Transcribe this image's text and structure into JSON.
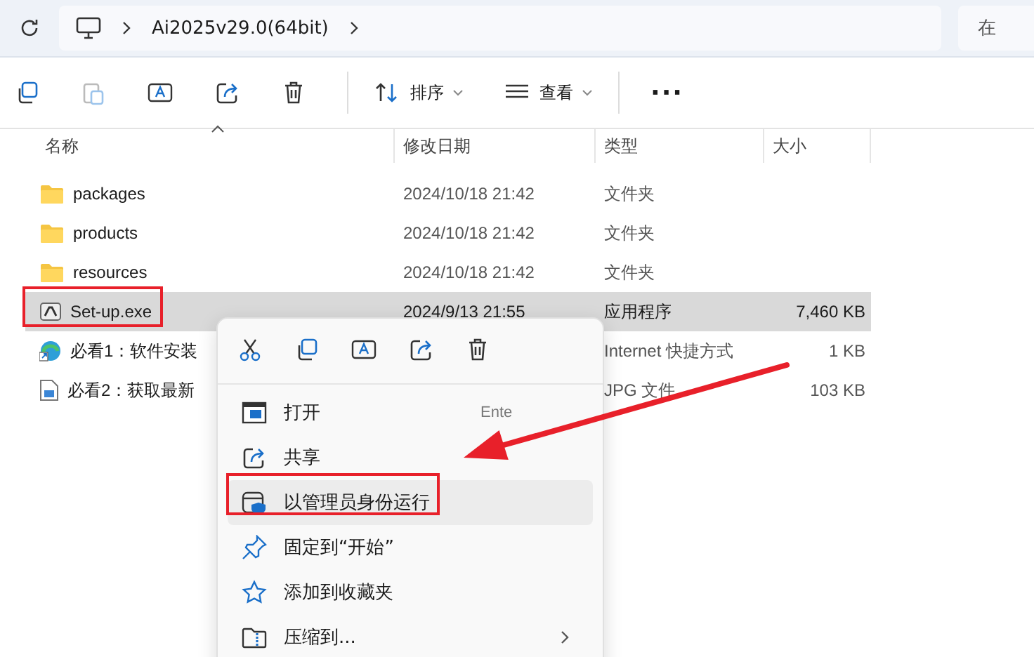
{
  "address_bar": {
    "path": [
      "Ai2025v29.0(64bit)"
    ],
    "search_placeholder": "在"
  },
  "toolbar": {
    "sort_label": "排序",
    "view_label": "查看",
    "more": "···"
  },
  "table": {
    "columns": [
      "名称",
      "修改日期",
      "类型",
      "大小"
    ],
    "rows": [
      {
        "kind": "folder",
        "name": "packages",
        "date": "2024/10/18 21:42",
        "type": "文件夹",
        "selected": false
      },
      {
        "kind": "folder",
        "name": "products",
        "date": "2024/10/18 21:42",
        "type": "文件夹",
        "selected": false
      },
      {
        "kind": "folder",
        "name": "resources",
        "date": "2024/10/18 21:42",
        "type": "文件夹",
        "selected": false
      },
      {
        "kind": "exe",
        "name": "Set-up.exe",
        "date": "2024/9/13 21:55",
        "type": "应用程序",
        "size": "7,460 KB",
        "selected": true
      },
      {
        "kind": "shortcut",
        "name": "必看1：软件安装",
        "type": "Internet 快捷方式",
        "size": "1 KB",
        "selected": false
      },
      {
        "kind": "image",
        "name": "必看2：获取最新",
        "type": "JPG 文件",
        "size": "103 KB",
        "selected": false
      }
    ]
  },
  "context_menu": {
    "items": [
      {
        "kind": "open",
        "label": "打开",
        "shortcut": "Ente",
        "highlighted": false,
        "submenu": false
      },
      {
        "kind": "share",
        "label": "共享",
        "highlighted": false,
        "submenu": false
      },
      {
        "kind": "admin",
        "label": "以管理员身份运行",
        "highlighted": true,
        "submenu": false
      },
      {
        "kind": "pin",
        "label": "固定到“开始”",
        "highlighted": false,
        "submenu": false
      },
      {
        "kind": "star",
        "label": "添加到收藏夹",
        "highlighted": false,
        "submenu": false
      },
      {
        "kind": "zip",
        "label": "压缩到...",
        "highlighted": false,
        "submenu": true
      }
    ]
  }
}
